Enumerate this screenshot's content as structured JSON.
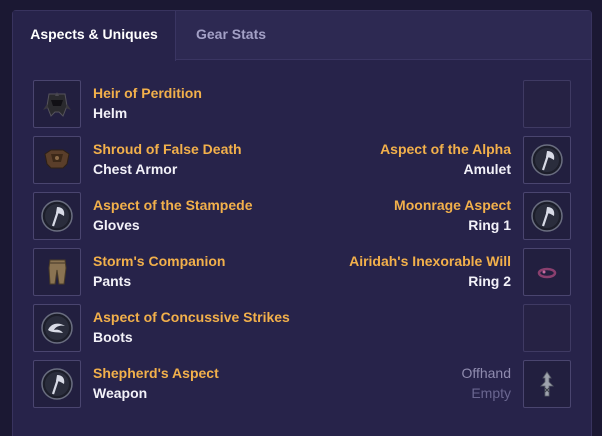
{
  "tabs": [
    {
      "label": "Aspects & Uniques",
      "active": true
    },
    {
      "label": "Gear Stats",
      "active": false
    }
  ],
  "left_slots": [
    {
      "name": "Heir of Perdition",
      "slot": "Helm",
      "icon": "helm-icon"
    },
    {
      "name": "Shroud of False Death",
      "slot": "Chest Armor",
      "icon": "chest-armor-icon"
    },
    {
      "name": "Aspect of the Stampede",
      "slot": "Gloves",
      "icon": "aspect-axe-icon"
    },
    {
      "name": "Storm's Companion",
      "slot": "Pants",
      "icon": "pants-icon"
    },
    {
      "name": "Aspect of Concussive Strikes",
      "slot": "Boots",
      "icon": "aspect-wave-icon"
    },
    {
      "name": "Shepherd's Aspect",
      "slot": "Weapon",
      "icon": "aspect-axe-icon"
    }
  ],
  "right_slots": [
    {
      "name": "",
      "slot": "",
      "icon": "empty-slot"
    },
    {
      "name": "Aspect of the Alpha",
      "slot": "Amulet",
      "icon": "aspect-axe-icon"
    },
    {
      "name": "Moonrage Aspect",
      "slot": "Ring 1",
      "icon": "aspect-axe-icon"
    },
    {
      "name": "Airidah's Inexorable Will",
      "slot": "Ring 2",
      "icon": "ring-icon"
    },
    {
      "name": "",
      "slot": "",
      "icon": "empty-slot"
    },
    {
      "name": "Offhand",
      "slot": "Empty",
      "icon": "offhand-totem-icon"
    }
  ],
  "colors": {
    "item_name": "#f2b04b",
    "slot_label": "#f2f1f8",
    "background": "#27234a"
  }
}
